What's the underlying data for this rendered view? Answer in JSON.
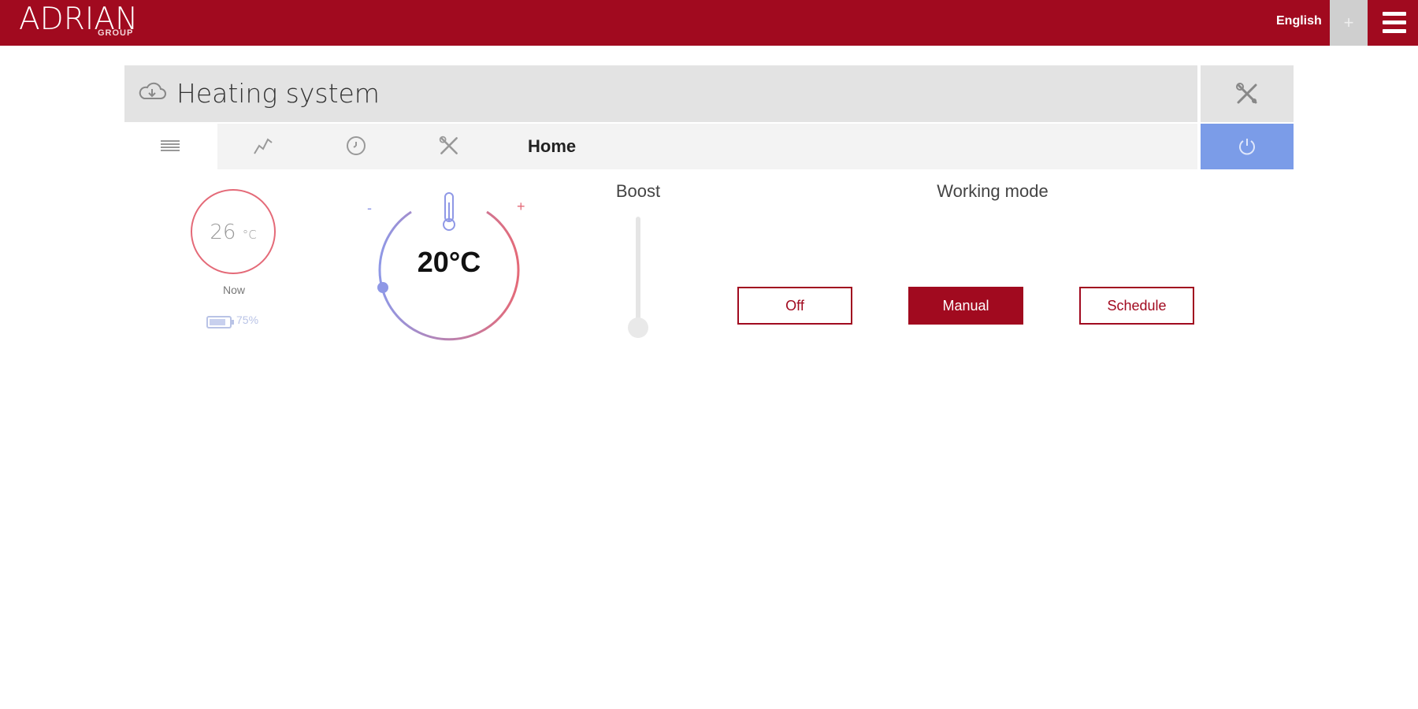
{
  "brand": {
    "name": "ADRIAN",
    "sub": "GROUP"
  },
  "topbar": {
    "language": "English",
    "plus_label": "+"
  },
  "header": {
    "title": "Heating system"
  },
  "tabs": {
    "home_label": "Home"
  },
  "current": {
    "value": "26",
    "unit": "°C",
    "label": "Now",
    "battery": "75%"
  },
  "thermostat": {
    "setpoint": "20°C",
    "minus": "-",
    "plus": "+"
  },
  "boost": {
    "label": "Boost",
    "level": 0
  },
  "working_mode": {
    "label": "Working mode",
    "options": [
      "Off",
      "Manual",
      "Schedule"
    ],
    "selected": "Manual"
  },
  "colors": {
    "brand": "#a10a1f",
    "power": "#7b9ce8",
    "cold": "#8f98e6",
    "hot": "#e46a78"
  }
}
